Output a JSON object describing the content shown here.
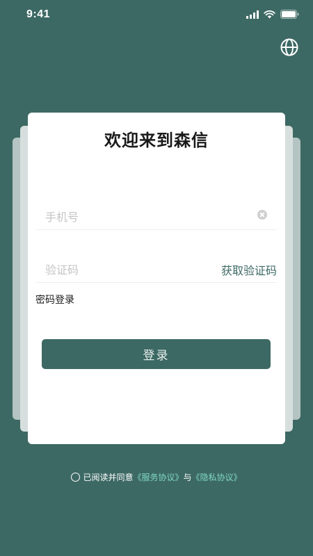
{
  "status_bar": {
    "time": "9:41"
  },
  "card": {
    "title": "欢迎来到森信"
  },
  "phone_field": {
    "placeholder": "手机号",
    "value": ""
  },
  "code_field": {
    "placeholder": "验证码",
    "value": "",
    "get_code_label": "获取验证码"
  },
  "password_login_label": "密码登录",
  "login_button_label": "登录",
  "agreement": {
    "prefix": "已阅读并同意",
    "service_link": "《服务协议》",
    "joiner": "与",
    "privacy_link": "《隐私协议》"
  },
  "colors": {
    "background": "#3d6964",
    "accent": "#3d6964",
    "link": "#7fd8c0"
  },
  "icons": [
    "signal-icon",
    "wifi-icon",
    "battery-icon",
    "globe-icon",
    "clear-icon",
    "radio-icon"
  ]
}
